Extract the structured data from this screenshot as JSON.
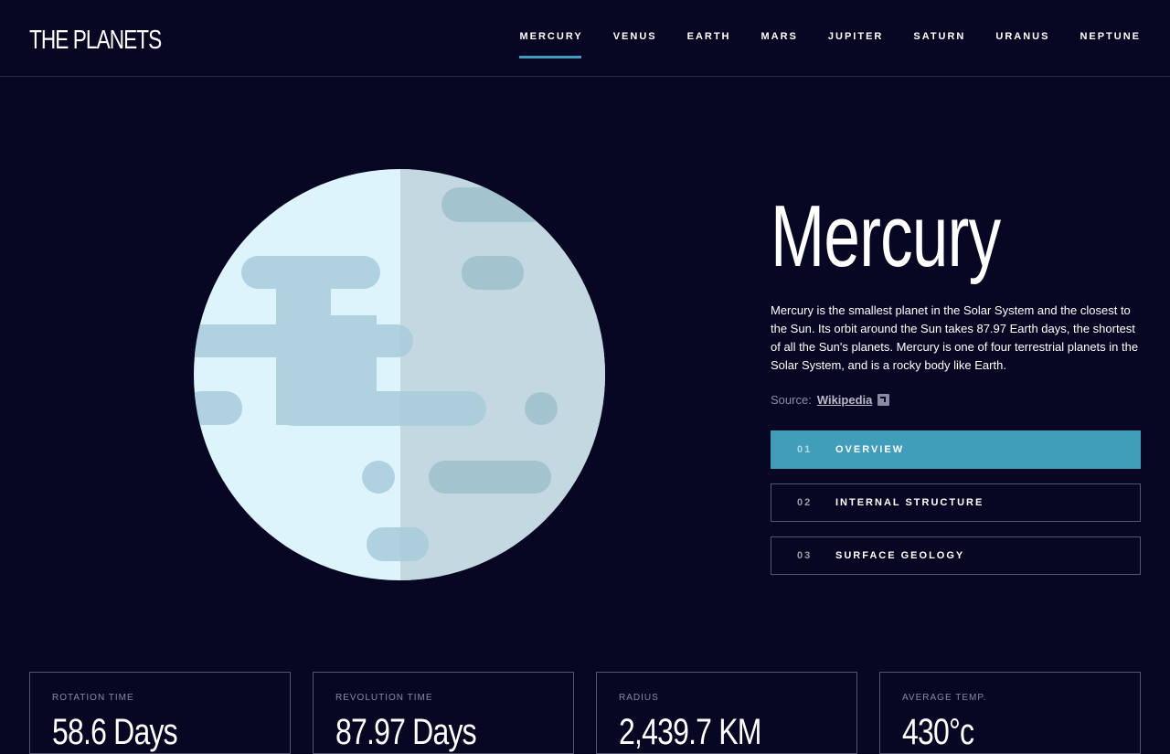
{
  "header": {
    "logo": "THE PLANETS",
    "nav": [
      "MERCURY",
      "VENUS",
      "EARTH",
      "MARS",
      "JUPITER",
      "SATURN",
      "URANUS",
      "NEPTUNE"
    ],
    "active": "MERCURY",
    "accent": "#419EBB"
  },
  "planet": {
    "name": "Mercury",
    "description": "Mercury is the smallest planet in the Solar System and the closest to the Sun. Its orbit around the Sun takes 87.97 Earth days, the shortest of all the Sun's planets. Mercury is one of four terrestrial planets in the Solar System, and is a rocky body like Earth.",
    "source_label": "Source:",
    "source_link": "Wikipedia",
    "image_icon": "mercury-planet-illustration"
  },
  "tabs": [
    {
      "num": "01",
      "label": "OVERVIEW"
    },
    {
      "num": "02",
      "label": "INTERNAL STRUCTURE"
    },
    {
      "num": "03",
      "label": "SURFACE GEOLOGY"
    }
  ],
  "stats": [
    {
      "label": "ROTATION TIME",
      "value": "58.6 Days"
    },
    {
      "label": "REVOLUTION TIME",
      "value": "87.97 Days"
    },
    {
      "label": "RADIUS",
      "value": "2,439.7 KM"
    },
    {
      "label": "AVERAGE TEMP.",
      "value": "430°c"
    }
  ],
  "colors": {
    "background": "#070724",
    "planet_light": "#DEF4FC",
    "planet_shade": "#CCE0E7",
    "crater": "#B0D2E0"
  }
}
